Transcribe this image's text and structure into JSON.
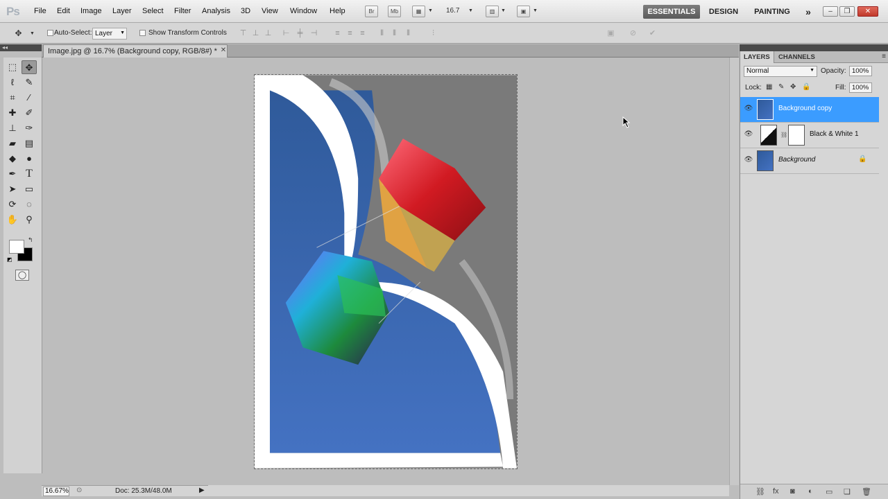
{
  "app": {
    "logo": "Ps",
    "menu": [
      "File",
      "Edit",
      "Image",
      "Layer",
      "Select",
      "Filter",
      "Analysis",
      "3D",
      "View",
      "Window",
      "Help"
    ],
    "zoom_field": "16.7",
    "workspaces": [
      "ESSENTIALS",
      "DESIGN",
      "PAINTING"
    ],
    "window_controls": [
      "minimize",
      "restore",
      "close"
    ]
  },
  "options_bar": {
    "auto_select_label": "Auto-Select:",
    "auto_select_target": "Layer",
    "show_transform_label": "Show Transform Controls"
  },
  "document": {
    "tab_title": "Image.jpg @ 16.7% (Background copy, RGB/8#) *",
    "zoom": "16.67%",
    "doc_size": "Doc: 25.3M/48.0M"
  },
  "tools": [
    "marquee-tool",
    "move-tool",
    "lasso-tool",
    "quick-selection-tool",
    "crop-tool",
    "eyedropper-tool",
    "healing-brush-tool",
    "brush-tool",
    "clone-stamp-tool",
    "history-brush-tool",
    "eraser-tool",
    "gradient-tool",
    "blur-tool",
    "dodge-tool",
    "pen-tool",
    "type-tool",
    "path-selection-tool",
    "rectangle-tool",
    "3d-rotate-tool",
    "3d-orbit-tool",
    "hand-tool",
    "zoom-tool"
  ],
  "colors": {
    "foreground": "#ffffff",
    "background": "#000000",
    "selection": "#3b9cff",
    "sky": "#3f6db5"
  },
  "layers_panel": {
    "tabs": [
      "LAYERS",
      "CHANNELS"
    ],
    "blend_mode": "Normal",
    "opacity_label": "Opacity:",
    "opacity": "100%",
    "lock_label": "Lock:",
    "fill_label": "Fill:",
    "fill": "100%",
    "layers": [
      {
        "name": "Background copy",
        "selected": true,
        "locked": false,
        "italic": false
      },
      {
        "name": "Black & White 1",
        "selected": false,
        "locked": false,
        "italic": false
      },
      {
        "name": "Background",
        "selected": false,
        "locked": true,
        "italic": true
      }
    ]
  }
}
